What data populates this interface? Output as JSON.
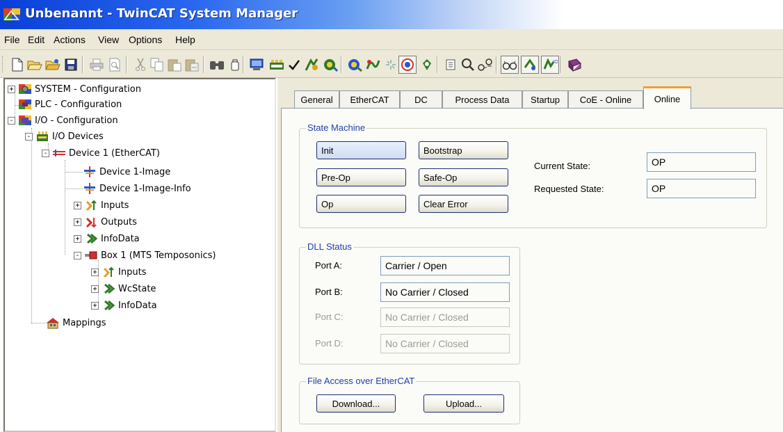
{
  "window": {
    "title": "Unbenannt - TwinCAT System Manager"
  },
  "menu": [
    "File",
    "Edit",
    "Actions",
    "View",
    "Options",
    "Help"
  ],
  "toolbar": {
    "icons": [
      "new-icon",
      "open-icon",
      "open-project-icon",
      "save-icon",
      "print-icon",
      "print-preview-icon",
      "cut-icon",
      "copy-icon",
      "paste-icon",
      "paste-with-links-icon",
      "find-icon",
      "find-next-icon",
      "generate-mappings-icon",
      "check-configuration-icon",
      "activate-configuration-icon",
      "set-run-mode-icon",
      "restart-config-mode-icon",
      "reload-devices-icon",
      "scan-devices-icon",
      "toggle-free-run-icon",
      "online-icon",
      "show-variables-icon",
      "zoom-icon",
      "mapping-icon",
      "online-watch-icon",
      "show-online-data-icon",
      "show-sub-items-icon",
      "help-icon"
    ]
  },
  "tree": {
    "items": [
      {
        "label": "SYSTEM - Configuration",
        "icon": "system-config-icon",
        "expander": "+"
      },
      {
        "label": "PLC - Configuration",
        "icon": "plc-config-icon",
        "expander": ""
      },
      {
        "label": "I/O - Configuration",
        "icon": "io-config-icon",
        "expander": "-"
      },
      {
        "label": "I/O Devices",
        "icon": "io-devices-icon",
        "expander": "-"
      },
      {
        "label": "Device 1 (EtherCAT)",
        "icon": "ethercat-device-icon",
        "expander": "-"
      },
      {
        "label": "Device 1-Image",
        "icon": "image-icon",
        "expander": ""
      },
      {
        "label": "Device 1-Image-Info",
        "icon": "image-info-icon",
        "expander": ""
      },
      {
        "label": "Inputs",
        "icon": "inputs-icon",
        "expander": "+"
      },
      {
        "label": "Outputs",
        "icon": "outputs-icon",
        "expander": "+"
      },
      {
        "label": "InfoData",
        "icon": "infodata-icon",
        "expander": "+"
      },
      {
        "label": "Box 1 (MTS Temposonics)",
        "icon": "box-icon",
        "expander": "-"
      },
      {
        "label": "Inputs",
        "icon": "inputs-icon",
        "expander": "+"
      },
      {
        "label": "WcState",
        "icon": "wcstate-icon",
        "expander": "+"
      },
      {
        "label": "InfoData",
        "icon": "infodata-icon",
        "expander": "+"
      },
      {
        "label": "Mappings",
        "icon": "mappings-icon",
        "expander": ""
      }
    ]
  },
  "tabs": [
    {
      "label": "General"
    },
    {
      "label": "EtherCAT"
    },
    {
      "label": "DC"
    },
    {
      "label": "Process Data"
    },
    {
      "label": "Startup"
    },
    {
      "label": "CoE - Online"
    },
    {
      "label": "Online",
      "active": true
    }
  ],
  "state_machine": {
    "title": "State Machine",
    "buttons": {
      "init": "Init",
      "bootstrap": "Bootstrap",
      "preop": "Pre-Op",
      "safeop": "Safe-Op",
      "op": "Op",
      "clear_error": "Clear Error"
    },
    "current_state_label": "Current State:",
    "current_state_value": "OP",
    "requested_state_label": "Requested State:",
    "requested_state_value": "OP"
  },
  "dll_status": {
    "title": "DLL Status",
    "ports": [
      {
        "label": "Port A:",
        "value": "Carrier / Open",
        "enabled": true
      },
      {
        "label": "Port B:",
        "value": "No Carrier / Closed",
        "enabled": true
      },
      {
        "label": "Port C:",
        "value": "No Carrier / Closed",
        "enabled": false
      },
      {
        "label": "Port D:",
        "value": "No Carrier / Closed",
        "enabled": false
      }
    ]
  },
  "file_access": {
    "title": "File Access over EtherCAT",
    "download": "Download...",
    "upload": "Upload..."
  },
  "colors": {
    "titlebar_start": "#0a3fd8",
    "window_bg": "#ece9d8",
    "group_title": "#1f3fa8",
    "active_tab_accent": "#f0a030"
  }
}
